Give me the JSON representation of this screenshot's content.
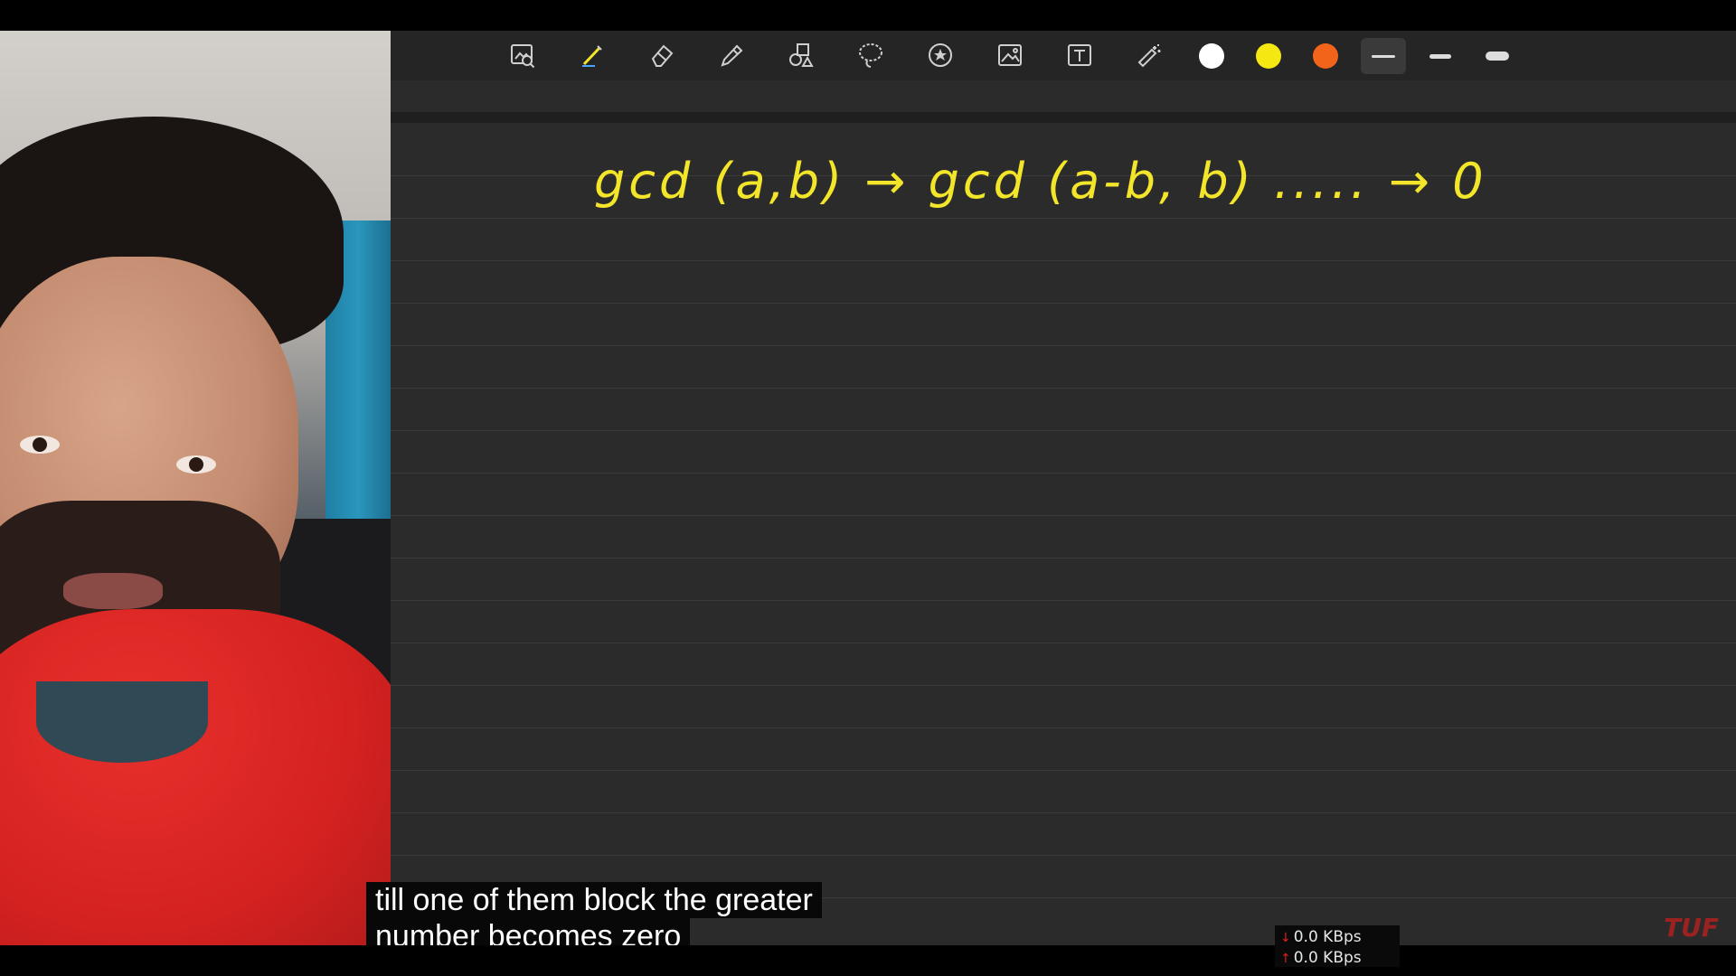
{
  "toolbar": {
    "tools": [
      {
        "icon": "image-search-icon",
        "label": ""
      },
      {
        "icon": "pen-icon",
        "label": ""
      },
      {
        "icon": "eraser-icon",
        "label": ""
      },
      {
        "icon": "highlighter-icon",
        "label": ""
      },
      {
        "icon": "shapes-icon",
        "label": ""
      },
      {
        "icon": "lasso-icon",
        "label": ""
      },
      {
        "icon": "sticker-icon",
        "label": ""
      },
      {
        "icon": "image-icon",
        "label": ""
      },
      {
        "icon": "text-box-icon",
        "label": ""
      },
      {
        "icon": "magic-wand-icon",
        "label": ""
      }
    ],
    "colors": [
      "#ffffff",
      "#f5e812",
      "#f2641a"
    ],
    "stroke_widths": [
      "thin",
      "medium",
      "thick"
    ],
    "selected_tool": "pen-icon",
    "selected_stroke": "thin"
  },
  "board": {
    "handwriting": "gcd (a,b) → gcd (a-b, b) ..... → 0",
    "ink_color": "#f2e52a"
  },
  "captions": {
    "line1": "till one of them block the greater",
    "line2": "number becomes zero"
  },
  "netspeed": {
    "download": "0.0 KBps",
    "upload": "0.0 KBps"
  },
  "watermark": "TUF"
}
